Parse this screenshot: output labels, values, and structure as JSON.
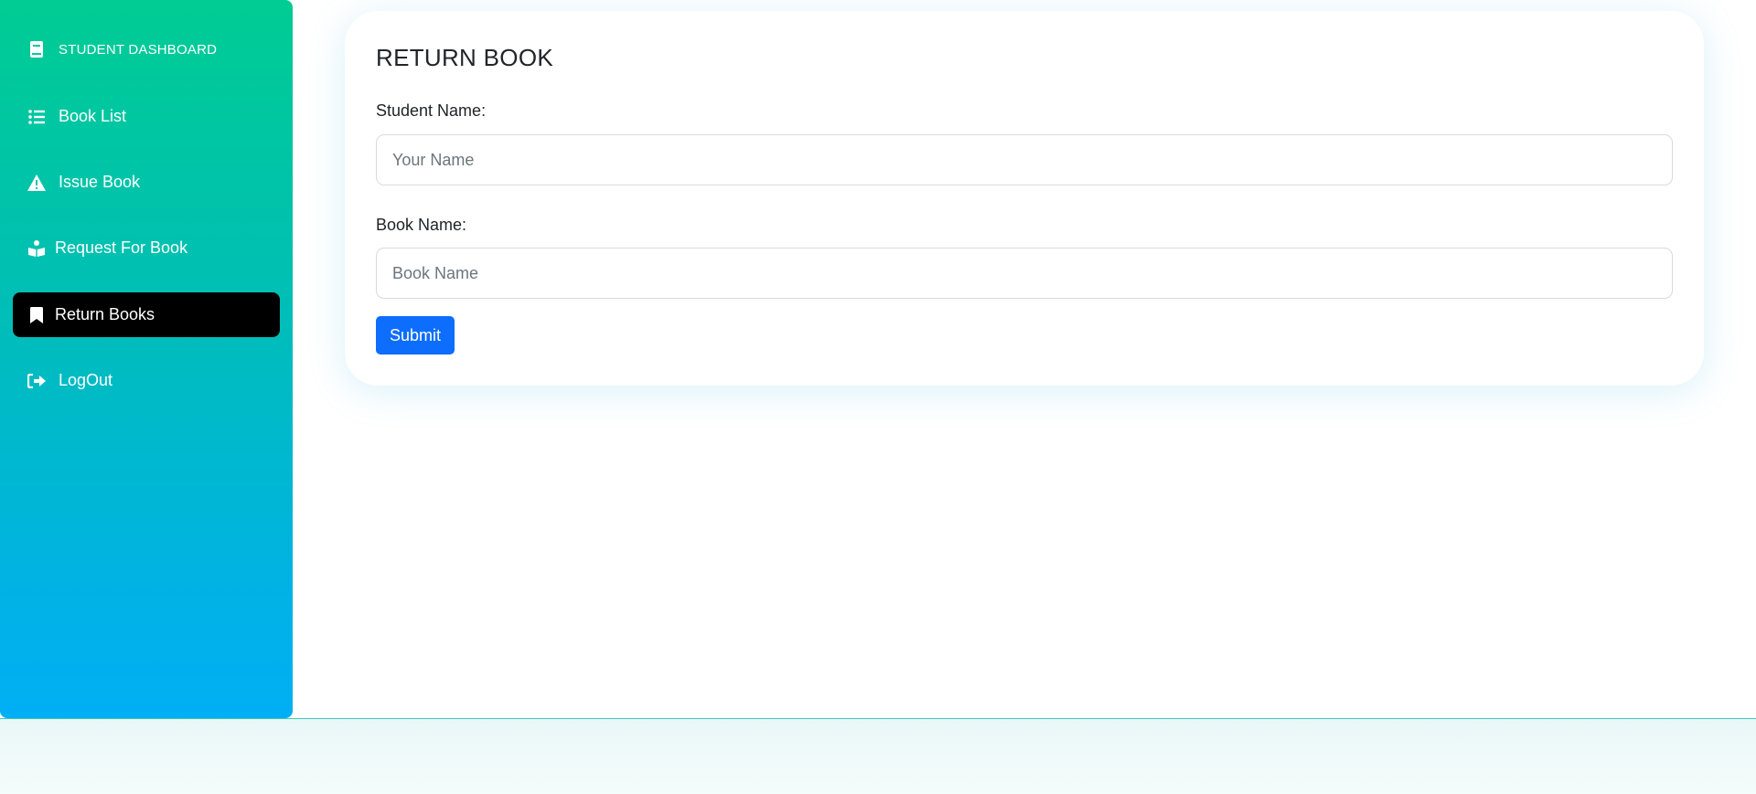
{
  "sidebar": {
    "brand": {
      "label": "STUDENT DASHBOARD",
      "icon": "book-icon"
    },
    "items": [
      {
        "label": "Book List",
        "icon": "list-icon",
        "active": false
      },
      {
        "label": "Issue Book",
        "icon": "warning-icon",
        "active": false
      },
      {
        "label": "Request For Book",
        "icon": "reading-person-icon",
        "active": false
      },
      {
        "label": "Return Books",
        "icon": "bookmark-icon",
        "active": true
      },
      {
        "label": "LogOut",
        "icon": "logout-icon",
        "active": false
      }
    ]
  },
  "form": {
    "title": "RETURN BOOK",
    "student_name_label": "Student Name:",
    "student_name_placeholder": "Your Name",
    "student_name_value": "",
    "book_name_label": "Book Name:",
    "book_name_placeholder": "Book Name",
    "book_name_value": "",
    "submit_label": "Submit"
  },
  "colors": {
    "sidebar_gradient_top": "#00cc93",
    "sidebar_gradient_bottom": "#00aff4",
    "active_item_bg": "#000000",
    "submit_button": "#0d6efd"
  }
}
